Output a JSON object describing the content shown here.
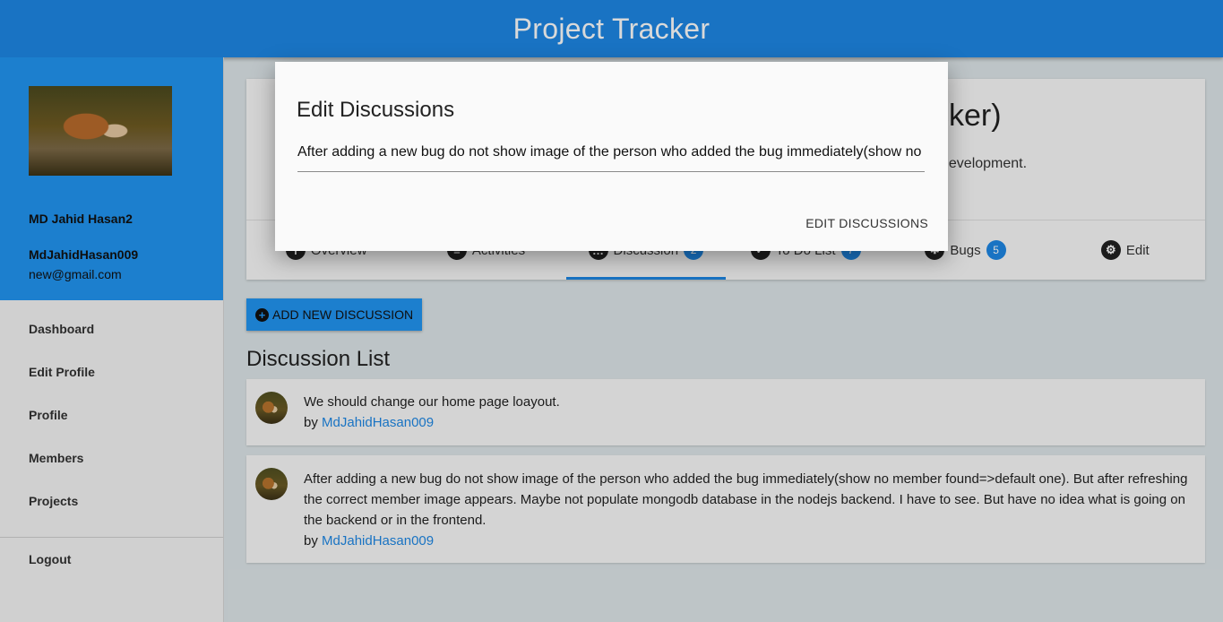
{
  "app": {
    "title": "Project Tracker"
  },
  "sidebar": {
    "user_name": "MD Jahid Hasan2",
    "user_handle": "MdJahidHasan009",
    "user_email": "new@gmail.com",
    "nav": [
      "Dashboard",
      "Edit Profile",
      "Profile",
      "Members",
      "Projects"
    ],
    "logout": "Logout"
  },
  "project": {
    "title_visible": "cker)",
    "desc_visible": "development."
  },
  "tabs": [
    {
      "label": "Overview",
      "icon": "info-icon"
    },
    {
      "label": "Activities",
      "icon": "clipboard-icon"
    },
    {
      "label": "Discussion",
      "icon": "chat-icon",
      "badge": "2"
    },
    {
      "label": "To Do List",
      "icon": "check-icon",
      "badge": "7"
    },
    {
      "label": "Bugs",
      "icon": "bug-icon",
      "badge": "5"
    },
    {
      "label": "Edit",
      "icon": "gear-icon"
    }
  ],
  "discussions": {
    "add_button": "ADD NEW DISCUSSION",
    "list_title": "Discussion List",
    "by_prefix": "by",
    "items": [
      {
        "text": "We should change our home page loayout.",
        "author": "MdJahidHasan009"
      },
      {
        "text": "After adding a new bug do not show image of the person who added the bug immediately(show no member found=>default one). But after refreshing the correct member image appears. Maybe not populate mongodb database in the nodejs backend. I have to see. But have no idea what is going on the backend or in the frontend.",
        "author": "MdJahidHasan009"
      }
    ]
  },
  "dialog": {
    "title": "Edit Discussions",
    "field_value": "After adding a new bug do not show image of the person who added the bug immediately(show no member found=>default one). But after refreshing the correct member image appears. Maybe not populate mongodb database in the nodejs backend. I have to see. But have no idea what is going on the backend or in the frontend.",
    "action": "EDIT DISCUSSIONS"
  },
  "colors": {
    "primary": "#1e88e5",
    "sidebar_profile": "#2196f3"
  }
}
